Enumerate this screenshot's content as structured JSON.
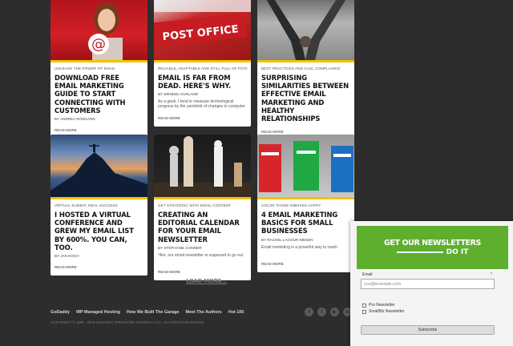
{
  "cards": [
    {
      "kicker": "Unleash the power of email",
      "title": "Download free email marketing guide to start connecting with customers",
      "byline": "By Andrea Rowland",
      "excerpt": "",
      "readmore": "Read more"
    },
    {
      "kicker": "Reliable, adaptable and still full of potential",
      "title": "Email is far from dead. Here's why.",
      "byline": "By Wendel Kurland",
      "excerpt": "As a geek, I tend to measure technological progress by the yardstick of changes in computer",
      "readmore": "Read more"
    },
    {
      "kicker": "Best practices and CASL compliance",
      "title": "Surprising similarities between effective email marketing and healthy relationships",
      "byline": "",
      "excerpt": "",
      "readmore": "Read more"
    },
    {
      "kicker": "Virtual summit, real success",
      "title": "I hosted a virtual conference and grew my email list by 600%. You can, too.",
      "byline": "By Jan Koch",
      "excerpt": "",
      "readmore": "Read more"
    },
    {
      "kicker": "Get strategic with email content",
      "title": "Creating an editorial calendar for your email newsletter",
      "byline": "By Stephanie Conner",
      "excerpt": "\"Are, our email newsletter is supposed to go out",
      "readmore": "Read more"
    },
    {
      "kicker": "Color those inboxes happy",
      "title": "4 email marketing basics for small businesses",
      "byline": "By Rachel Lacour Niesen",
      "excerpt": "Email marketing is a powerful way to reach",
      "readmore": "Read more"
    }
  ],
  "load_more": "LOAD MORE...",
  "footer": {
    "links": [
      "GoDaddy",
      "WP Managed Hosting",
      "How We Built The Garage",
      "Meet The Authors",
      "Hot 100"
    ],
    "copyright": "COPYRIGHT © 1999 - 2018 GODADDY OPERATING COMPANY, LLC. ALL RIGHTS RESERVED.",
    "social_icons": [
      "facebook-icon",
      "twitter-icon",
      "youtube-icon",
      "linkedin-icon"
    ]
  },
  "newsletter": {
    "heading_line1": "GET OUR NEWSLETTERS",
    "heading_line2": "DO IT",
    "email_label": "Email",
    "required_mark": "*",
    "email_placeholder": "you@example.com",
    "options": [
      "Pro Newsletter",
      "SmallBiz Newsletter"
    ],
    "submit_label": "Subscribe"
  },
  "colors": {
    "background": "#2d2d2d",
    "accent_yellow": "#f2c300",
    "newsletter_green": "#5faf2f"
  }
}
